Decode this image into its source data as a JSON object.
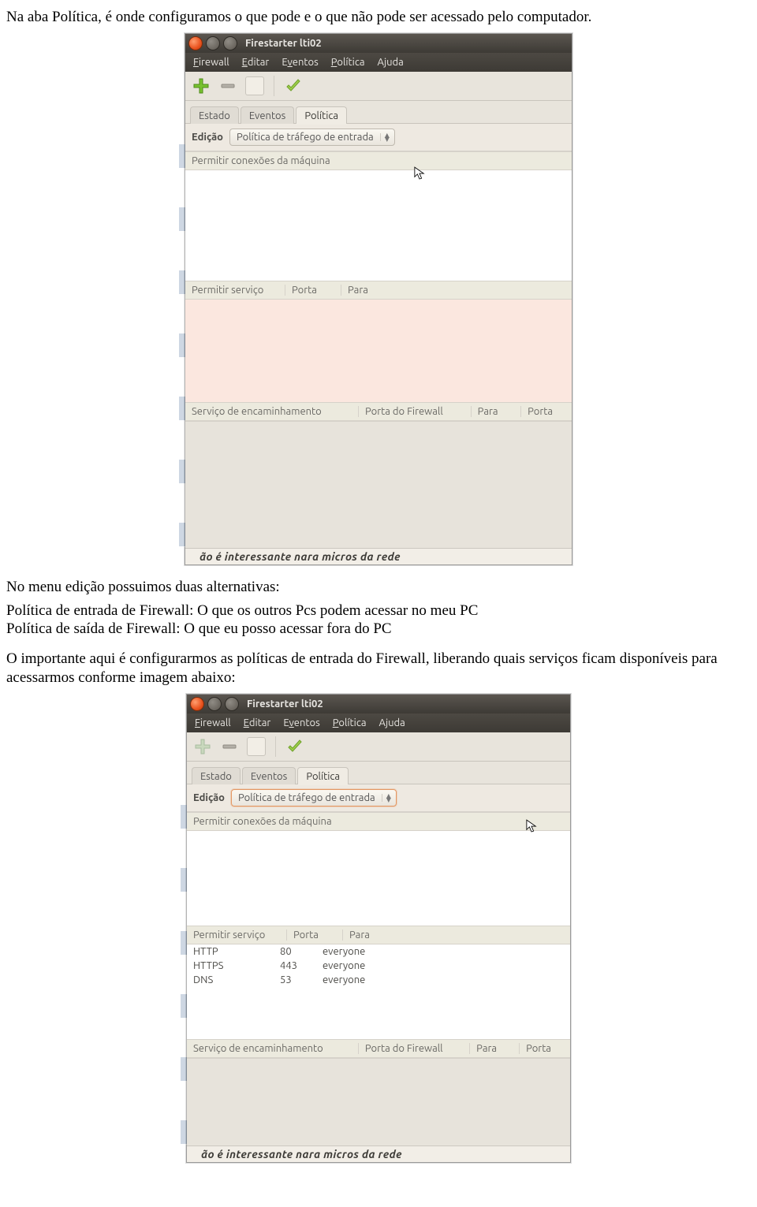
{
  "doc": {
    "p1": "Na aba Política, é onde configuramos o que pode e o que não pode ser acessado pelo computador.",
    "p2a": "No menu edição possuimos duas alternativas:",
    "p2b": "Política de entrada de Firewall: O que os outros Pcs podem acessar no meu PC",
    "p2c": "Política de saída de Firewall: O que eu posso acessar fora do PC",
    "p3": "O importante aqui é configurarmos as políticas de entrada do Firewall, liberando quais serviços ficam disponíveis para acessarmos conforme imagem abaixo:"
  },
  "window": {
    "title": "Firestarter lti02",
    "menu": {
      "firewall": "Firewall",
      "editar": "Editar",
      "eventos": "Eventos",
      "politica": "Política",
      "ajuda": "Ajuda"
    },
    "tabs": {
      "estado": "Estado",
      "eventos": "Eventos",
      "politica": "Política"
    },
    "edit_label": "Edição",
    "combo_value": "Política de tráfego de entrada",
    "section_conn": "Permitir conexões da máquina",
    "svc_header": {
      "service": "Permitir serviço",
      "port": "Porta",
      "para": "Para"
    },
    "fw_header": {
      "a": "Serviço de encaminhamento",
      "b": "Porta do Firewall",
      "c": "Para",
      "d": "Porta"
    },
    "cut_hint": "ão é interessante nara micros da rede"
  },
  "window2": {
    "services": [
      {
        "name": "HTTP",
        "port": "80",
        "para": "everyone"
      },
      {
        "name": "HTTPS",
        "port": "443",
        "para": "everyone"
      },
      {
        "name": "DNS",
        "port": "53",
        "para": "everyone"
      }
    ]
  }
}
